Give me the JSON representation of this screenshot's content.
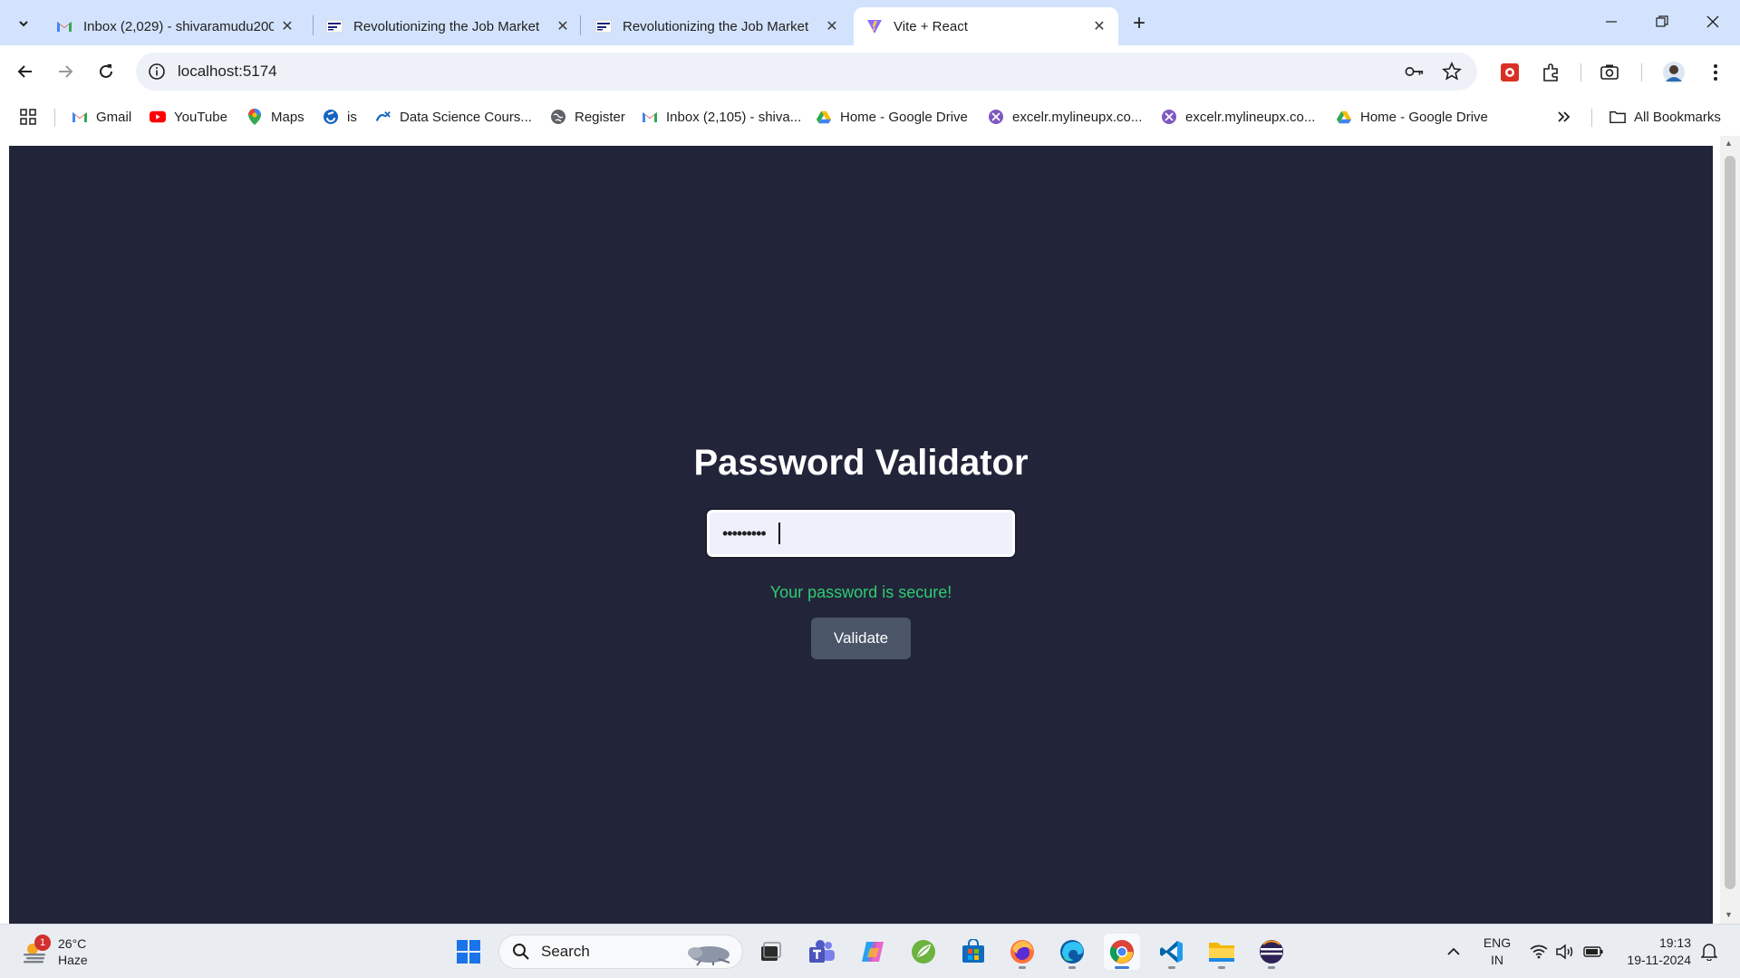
{
  "browser": {
    "tabs": [
      {
        "title": "Inbox (2,029) - shivaramudu200",
        "favicon": "gmail-icon",
        "active": false
      },
      {
        "title": "Revolutionizing the Job Market",
        "favicon": "nxtwave-icon",
        "active": false
      },
      {
        "title": "Revolutionizing the Job Market",
        "favicon": "nxtwave-icon",
        "active": false
      },
      {
        "title": "Vite + React",
        "favicon": "vite-icon",
        "active": true
      }
    ],
    "url": "localhost:5174",
    "bookmarks": [
      {
        "label": "Gmail",
        "icon": "gmail-icon"
      },
      {
        "label": "YouTube",
        "icon": "youtube-icon"
      },
      {
        "label": "Maps",
        "icon": "maps-icon"
      },
      {
        "label": "is",
        "icon": "is-icon"
      },
      {
        "label": "Data Science Cours...",
        "icon": "data-science-icon"
      },
      {
        "label": "Register",
        "icon": "globe-icon"
      },
      {
        "label": "Inbox (2,105) - shiva...",
        "icon": "gmail-icon"
      },
      {
        "label": "Home - Google Drive",
        "icon": "drive-icon"
      },
      {
        "label": "excelr.mylineupx.co...",
        "icon": "lineupx-icon"
      },
      {
        "label": "excelr.mylineupx.co...",
        "icon": "lineupx-icon"
      },
      {
        "label": "Home - Google Drive",
        "icon": "drive-icon"
      }
    ],
    "all_bookmarks": "All Bookmarks"
  },
  "page": {
    "title": "Password Validator",
    "password_masked": "•••••••••",
    "status_message": "Your password is secure!",
    "status_color": "#2ecc71",
    "validate_label": "Validate",
    "background_color": "#22253a"
  },
  "taskbar": {
    "weather_temp": "26°C",
    "weather_desc": "Haze",
    "weather_badge": "1",
    "search_placeholder": "Search",
    "lang_line1": "ENG",
    "lang_line2": "IN",
    "time": "19:13",
    "date": "19-11-2024"
  }
}
